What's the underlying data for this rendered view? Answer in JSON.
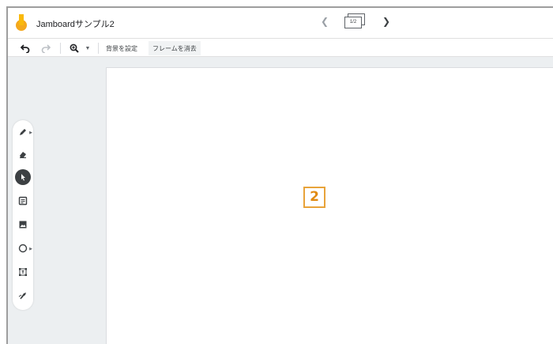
{
  "app": {
    "doc_title": "Jamboardサンプル2",
    "frame_indicator": "1/2",
    "colors": {
      "logo_orange": "#f4a81d",
      "logo_yellow": "#fdd663",
      "accent_badge": "#e8a33a"
    }
  },
  "toolbar": {
    "undo_icon": "undo-icon",
    "redo_icon": "redo-icon",
    "zoom_icon": "zoom-in-icon",
    "set_background_label": "背景を設定",
    "clear_frame_label": "フレームを消去"
  },
  "tools": [
    {
      "name": "pen-icon"
    },
    {
      "name": "eraser-icon"
    },
    {
      "name": "select-icon",
      "selected": true
    },
    {
      "name": "sticky-note-icon"
    },
    {
      "name": "image-icon"
    },
    {
      "name": "shape-circle-icon"
    },
    {
      "name": "text-box-icon"
    },
    {
      "name": "laser-icon"
    }
  ],
  "annotation": {
    "badge": "2"
  }
}
